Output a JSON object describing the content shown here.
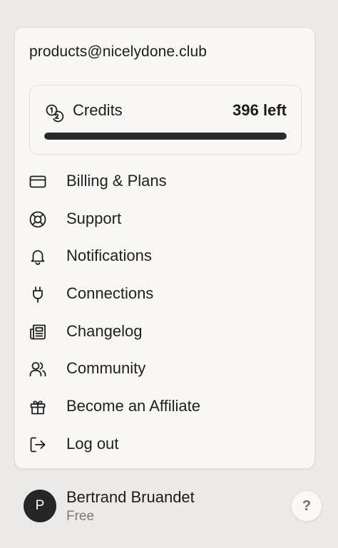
{
  "account": {
    "email": "products@nicelydone.club"
  },
  "credits": {
    "label": "Credits",
    "remaining_text": "396 left",
    "progress_fraction": 1.0,
    "icon": "coins-icon"
  },
  "menu": {
    "items": [
      {
        "label": "Billing & Plans",
        "icon": "credit-card-icon"
      },
      {
        "label": "Support",
        "icon": "lifebuoy-icon"
      },
      {
        "label": "Notifications",
        "icon": "bell-icon"
      },
      {
        "label": "Connections",
        "icon": "plug-icon"
      },
      {
        "label": "Changelog",
        "icon": "newspaper-icon"
      },
      {
        "label": "Community",
        "icon": "users-icon"
      },
      {
        "label": "Become an Affiliate",
        "icon": "gift-icon"
      },
      {
        "label": "Log out",
        "icon": "logout-icon"
      }
    ]
  },
  "user": {
    "initial": "P",
    "name": "Bertrand Bruandet",
    "plan": "Free"
  },
  "help": {
    "label": "?"
  },
  "colors": {
    "background": "#ebeae8",
    "card": "#f8f7f5",
    "text": "#1f1f1f",
    "muted": "#7a7a78",
    "progress_fill": "#2a2a2a",
    "avatar": "#262626"
  }
}
